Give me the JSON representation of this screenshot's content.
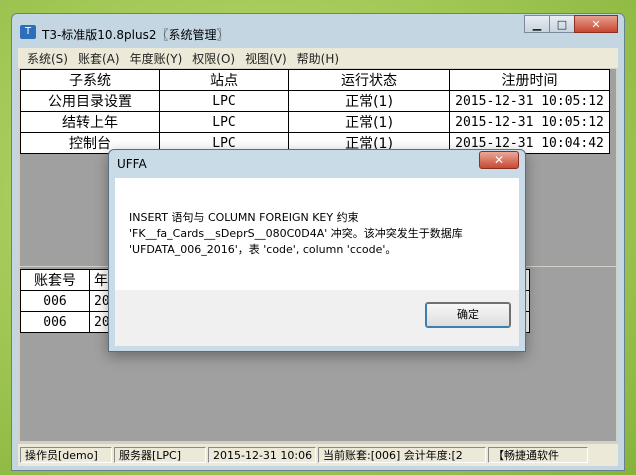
{
  "window": {
    "title": "T3-标准版10.8plus2〖系统管理〗",
    "min_label": "▁",
    "max_label": "□",
    "close_label": "✕"
  },
  "menu": [
    "系统(S)",
    "账套(A)",
    "年度账(Y)",
    "权限(O)",
    "视图(V)",
    "帮助(H)"
  ],
  "subsystems": {
    "headers": [
      "子系统",
      "站点",
      "运行状态",
      "注册时间"
    ],
    "rows": [
      [
        "公用目录设置",
        "LPC",
        "正常(1)",
        "2015-12-31 10:05:12"
      ],
      [
        "结转上年",
        "LPC",
        "正常(1)",
        "2015-12-31 10:05:12"
      ],
      [
        "控制台",
        "LPC",
        "正常(1)",
        "2015-12-31 10:04:42"
      ]
    ]
  },
  "accounts": {
    "headers": [
      "账套号",
      "年"
    ],
    "rows": [
      [
        "006",
        "20"
      ],
      [
        "006",
        "20"
      ]
    ]
  },
  "status": {
    "operator": "操作员[demo]",
    "server": "服务器[LPC]",
    "datetime": "2015-12-31 10:06",
    "account": "当前账套:[006] 会计年度:[2",
    "brand": "【畅捷通软件"
  },
  "dialog": {
    "title": "UFFA",
    "close_label": "✕",
    "message_lines": [
      "INSERT 语句与 COLUMN FOREIGN KEY 约束",
      "'FK__fa_Cards__sDeprS__080C0D4A' 冲突。该冲突发生于数据库",
      "'UFDATA_006_2016'，表 'code', column 'ccode'。"
    ],
    "ok_label": "确定"
  }
}
